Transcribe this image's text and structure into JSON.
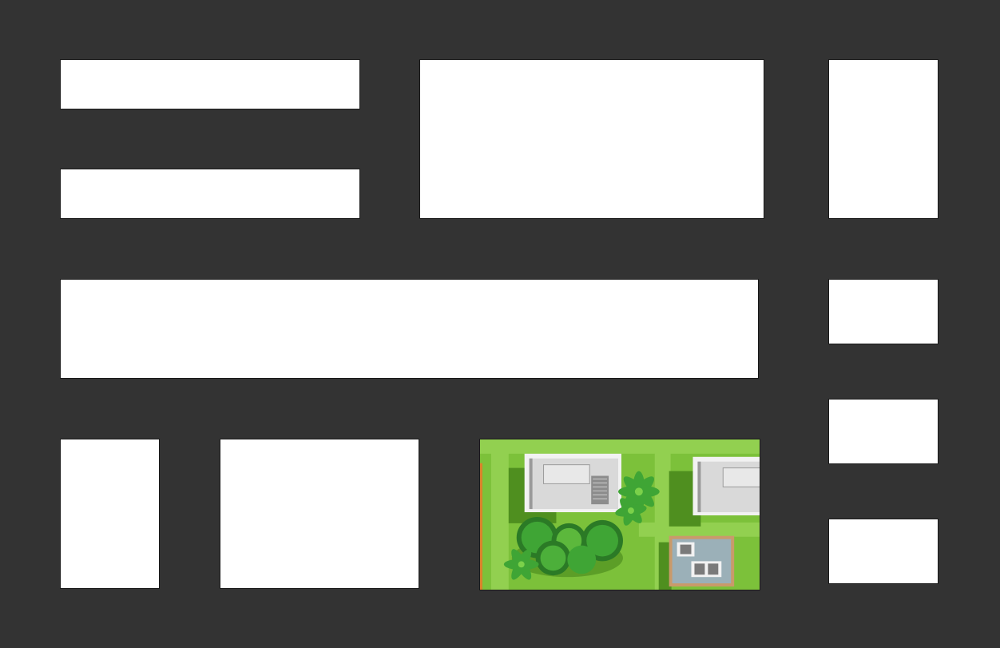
{
  "canvas": {
    "background": "#333333"
  },
  "panels": {
    "panel_fill": "#ffffff"
  },
  "thumbnail": {
    "subject": "aerial-garden-map-illustration",
    "colors": {
      "grass": "#7cc13a",
      "grass_light": "#92d050",
      "grass_dark": "#4f8f1f",
      "roof": "#d9d9d9",
      "roof_edge": "#f2f2f2",
      "tree": "#3fa535",
      "tree_dark": "#2b7a26",
      "patio": "#9bb0b8",
      "patio_edge": "#c99a6b"
    }
  }
}
